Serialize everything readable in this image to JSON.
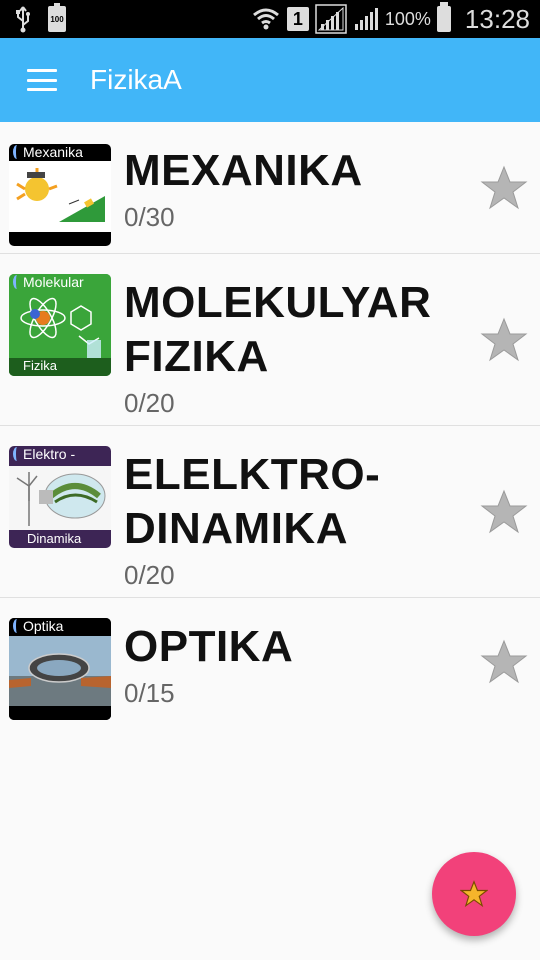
{
  "status_bar": {
    "battery_small_label": "100",
    "sim_label": "1",
    "battery_percent": "100%",
    "time": "13:28"
  },
  "app_bar": {
    "title": "FizikaA",
    "menu_icon": "hamburger-menu-icon"
  },
  "items": [
    {
      "thumb_label": "Mexanika",
      "thumb_sublabel": "",
      "title_lines": [
        "MEXANIKA"
      ],
      "progress": "0/30",
      "icon": "star-outline-icon"
    },
    {
      "thumb_label": "Molekular",
      "thumb_sublabel": "Fizika",
      "title_lines": [
        "MOLEKULYAR",
        "FIZIKA"
      ],
      "progress": "0/20",
      "icon": "star-outline-icon"
    },
    {
      "thumb_label": "Elektro -",
      "thumb_sublabel": "Dinamika",
      "title_lines": [
        "ELELKTRO-",
        "DINAMIKA"
      ],
      "progress": "0/20",
      "icon": "star-outline-icon"
    },
    {
      "thumb_label": "Optika",
      "thumb_sublabel": "",
      "title_lines": [
        "OPTIKA"
      ],
      "progress": "0/15",
      "icon": "star-outline-icon"
    }
  ],
  "fab": {
    "icon": "star-icon",
    "color": "#f2417a",
    "icon_color": "#f5b52b"
  },
  "colors": {
    "app_bar": "#41b6f8",
    "background": "#fafafa",
    "star_grey": "#b5b5b5"
  }
}
